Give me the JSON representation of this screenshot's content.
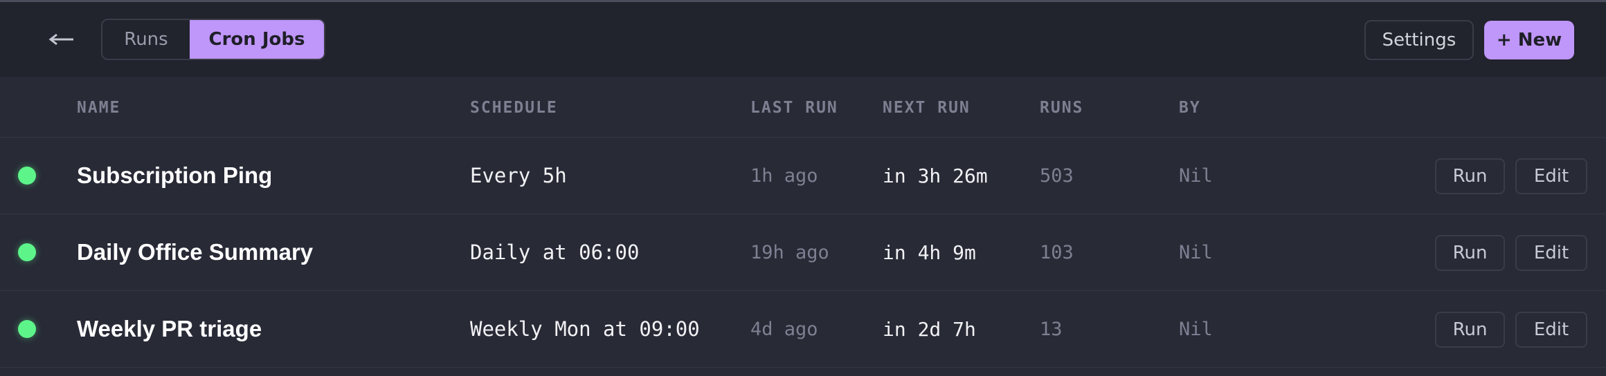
{
  "toolbar": {
    "back_icon": "arrow-left-icon",
    "tabs": [
      {
        "label": "Runs",
        "active": false
      },
      {
        "label": "Cron Jobs",
        "active": true
      }
    ],
    "settings_label": "Settings",
    "new_label": "+ New",
    "accent_color": "#bf96f9"
  },
  "table": {
    "columns": [
      "NAME",
      "SCHEDULE",
      "LAST RUN",
      "NEXT RUN",
      "RUNS",
      "BY"
    ],
    "rows": [
      {
        "status": "active",
        "name": "Subscription Ping",
        "schedule": "Every 5h",
        "last_run": "1h ago",
        "next_run": "in 3h 26m",
        "runs": "503",
        "by": "Nil",
        "run_label": "Run",
        "edit_label": "Edit"
      },
      {
        "status": "active",
        "name": "Daily Office Summary",
        "schedule": "Daily at 06:00",
        "last_run": "19h ago",
        "next_run": "in 4h 9m",
        "runs": "103",
        "by": "Nil",
        "run_label": "Run",
        "edit_label": "Edit"
      },
      {
        "status": "active",
        "name": "Weekly PR triage",
        "schedule": "Weekly Mon at 09:00",
        "last_run": "4d ago",
        "next_run": "in 2d 7h",
        "runs": "13",
        "by": "Nil",
        "run_label": "Run",
        "edit_label": "Edit"
      }
    ],
    "status_color": "#5df58a"
  }
}
